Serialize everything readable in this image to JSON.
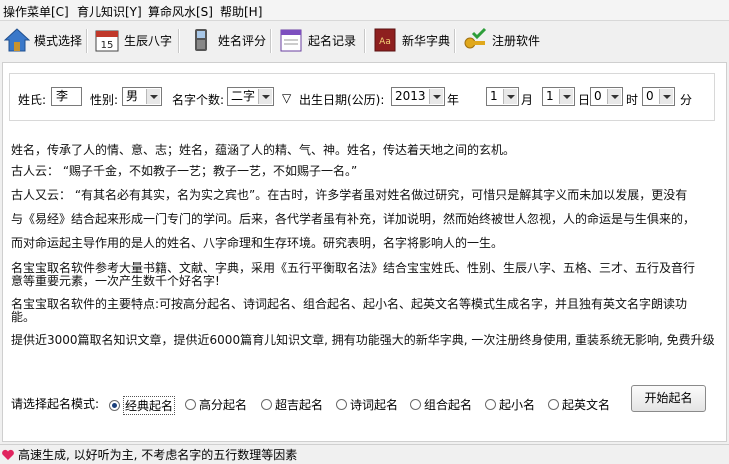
{
  "menu": [
    {
      "label": "操作菜单[C]"
    },
    {
      "label": "育儿知识[Y]"
    },
    {
      "label": "算命风水[S]"
    },
    {
      "label": "帮助[H]"
    }
  ],
  "toolbar": [
    {
      "label": "模式选择",
      "icon": "house-icon"
    },
    {
      "label": "生辰八字",
      "icon": "calendar-icon"
    },
    {
      "label": "姓名评分",
      "icon": "phone-icon"
    },
    {
      "label": "起名记录",
      "icon": "notepad-icon"
    },
    {
      "label": "新华字典",
      "icon": "dictionary-icon"
    },
    {
      "label": "注册软件",
      "icon": "key-icon"
    }
  ],
  "form": {
    "surname_label": "姓氏:",
    "surname_value": "李",
    "gender_label": "性别:",
    "gender_value": "男",
    "name_len_label": "名字个数:",
    "name_len_value": "二字",
    "birth_label": "出生日期(公历):",
    "triangle": "▽",
    "year_value": "2013",
    "year_unit": "年",
    "month_value": "1",
    "month_unit": "月",
    "day_value": "1",
    "day_unit": "日",
    "hour_value": "0",
    "hour_unit": "时",
    "minute_value": "0",
    "minute_unit": "分"
  },
  "paragraphs": [
    "姓名，传承了人的情、意、志；姓名，蕴涵了人的精、气、神。姓名，传达着天地之间的玄机。",
    "古人云：  “赐子千金，不如教子一艺；教子一艺，不如赐子一名。”",
    "古人又云：  “有其名必有其实，名为实之宾也”。在古时，许多学者虽对姓名做过研究，可惜只是解其字义而未加以发展，更没有",
    "与《易经》结合起来形成一门专门的学问。后来，各代学者虽有补充，详加说明，然而始终被世人忽视，人的命运是与生俱来的，",
    "而对命运起主导作用的是人的姓名、八字命理和生存环境。研究表明，名字将影响人的一生。",
    "名宝宝取名软件参考大量书籍、文献、字典，采用《五行平衡取名法》结合宝宝姓氏、性别、生辰八字、五格、三才、五行及音行",
    "意等重要元素，一次产生数千个好名字!",
    "名宝宝取名软件的主要特点:可按高分起名、诗词起名、组合起名、起小名、起英文名等模式生成名字，并且独有英文名字朗读功",
    "能。",
    "提供近3000篇取名知识文章，提供近6000篇育儿知识文章, 拥有功能强大的新华字典, 一次注册终身使用, 重装系统无影响, 免费升级"
  ],
  "mode": {
    "label": "请选择起名模式:",
    "options": [
      "经典起名",
      "高分起名",
      "超吉起名",
      "诗词起名",
      "组合起名",
      "起小名",
      "起英文名"
    ],
    "selected": "经典起名",
    "start_button": "开始起名"
  },
  "status": {
    "text": "高速生成, 以好听为主, 不考虑名字的五行数理等因素",
    "icon": "heart-icon"
  }
}
